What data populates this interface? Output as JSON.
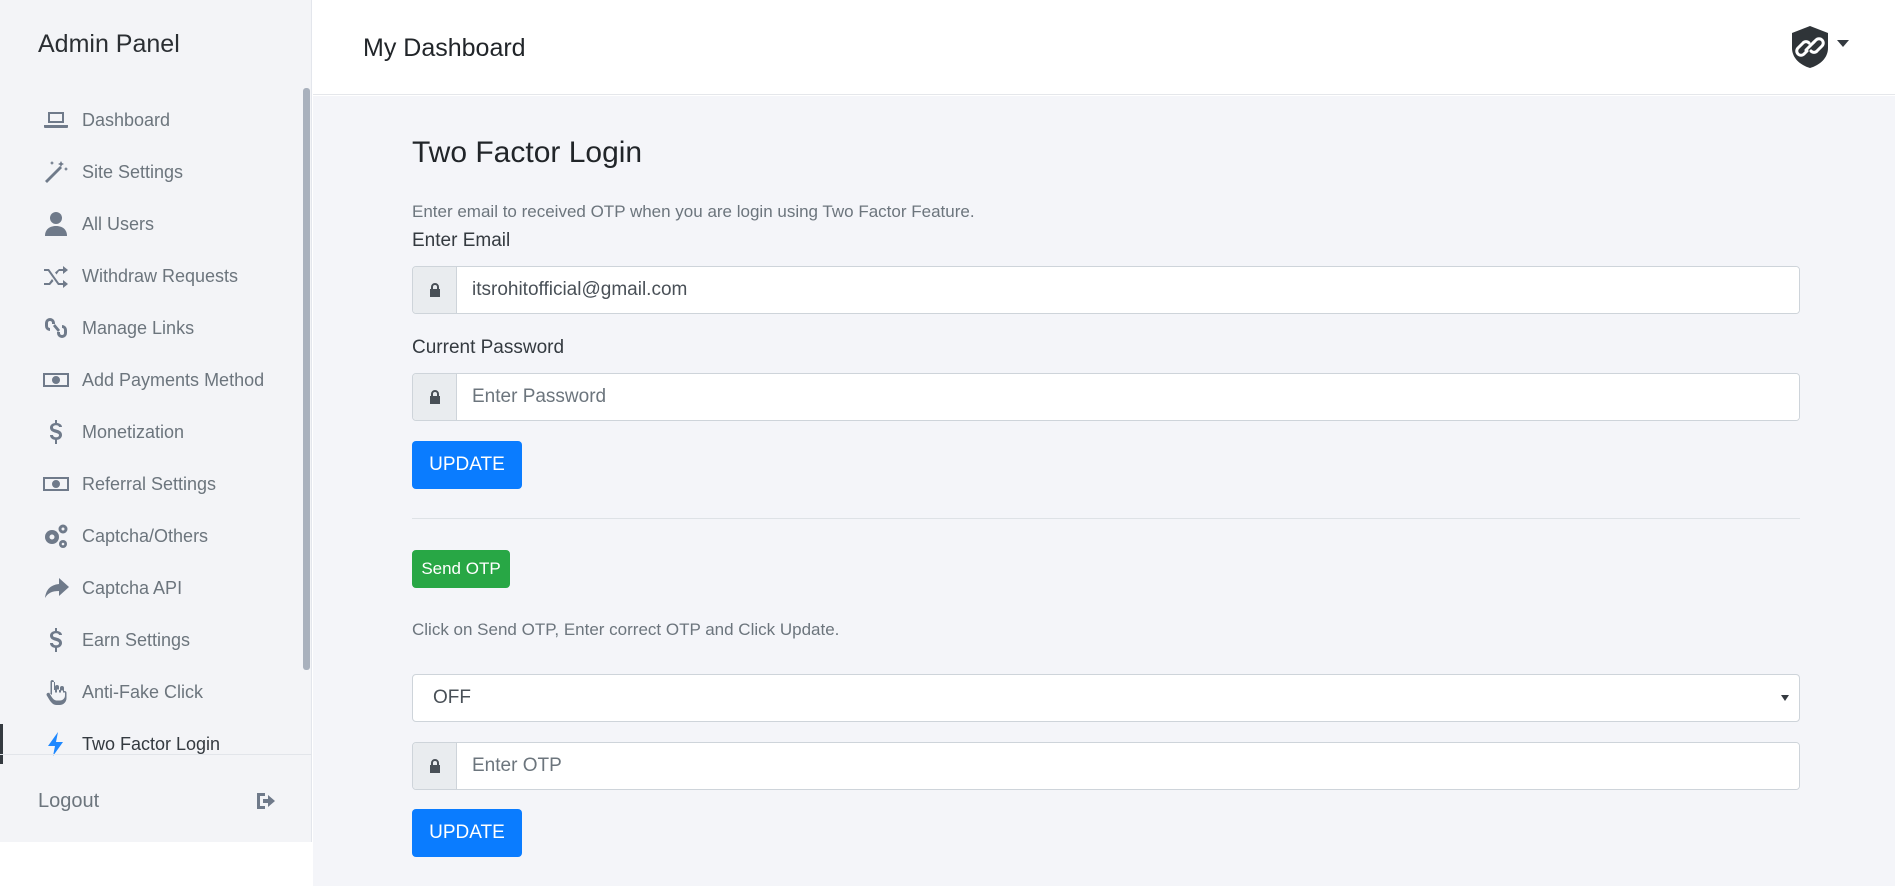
{
  "sidebar": {
    "brand": "Admin Panel",
    "items": [
      {
        "label": "Dashboard",
        "icon": "laptop-icon"
      },
      {
        "label": "Site Settings",
        "icon": "magic-wand-icon"
      },
      {
        "label": "All Users",
        "icon": "user-icon"
      },
      {
        "label": "Withdraw Requests",
        "icon": "shuffle-icon"
      },
      {
        "label": "Manage Links",
        "icon": "link-icon"
      },
      {
        "label": "Add Payments Method",
        "icon": "money-bill-icon"
      },
      {
        "label": "Monetization",
        "icon": "dollar-icon"
      },
      {
        "label": "Referral Settings",
        "icon": "money-bill-icon"
      },
      {
        "label": "Captcha/Others",
        "icon": "cogs-icon"
      },
      {
        "label": "Captcha API",
        "icon": "share-arrow-icon"
      },
      {
        "label": "Earn Settings",
        "icon": "dollar-icon"
      },
      {
        "label": "Anti-Fake Click",
        "icon": "hand-pointer-icon"
      },
      {
        "label": "Two Factor Login",
        "icon": "bolt-icon",
        "active": true
      }
    ],
    "logout_label": "Logout"
  },
  "header": {
    "title": "My Dashboard"
  },
  "main": {
    "heading": "Two Factor Login",
    "help_text": "Enter email to received OTP when you are login using Two Factor Feature.",
    "email_label": "Enter Email",
    "email_value": "itsrohitofficial@gmail.com",
    "password_label": "Current Password",
    "password_placeholder": "Enter Password",
    "update_label": "UPDATE",
    "send_otp_label": "Send OTP",
    "otp_help_text": "Click on Send OTP, Enter correct OTP and Click Update.",
    "status_select_value": "OFF",
    "otp_placeholder": "Enter OTP",
    "update2_label": "UPDATE"
  },
  "colors": {
    "primary": "#0a7cff",
    "success": "#28a745",
    "active_icon": "#1e88ff"
  }
}
